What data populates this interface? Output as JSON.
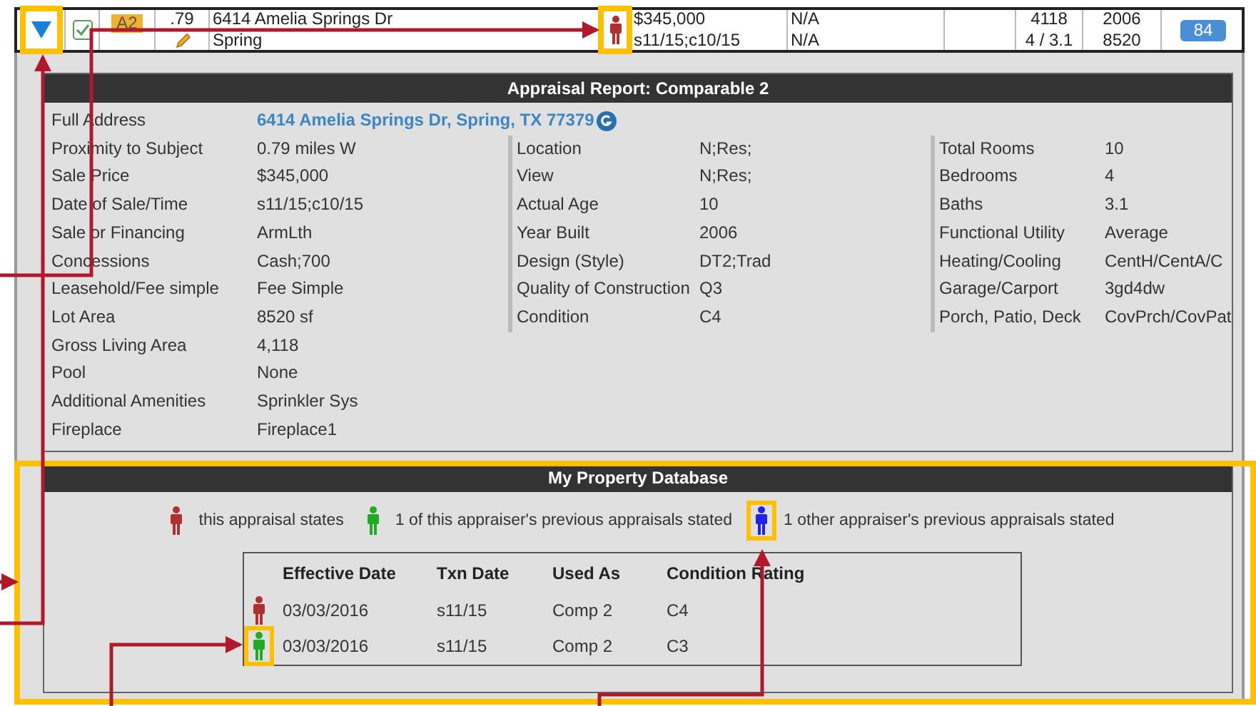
{
  "listing_row": {
    "expanded": true,
    "checked": true,
    "tag": "A2",
    "number": ".79",
    "address_lines": [
      "6414 Amelia Springs Dr",
      "Spring"
    ],
    "color": "#b03030",
    "price_lines": [
      "$345,000",
      "s11/15;c10/15"
    ],
    "column_8": [
      "N/A",
      "N/A"
    ],
    "size_lines": [
      "4118",
      "4 / 3.1"
    ],
    "year_lot_lines": [
      "2006",
      "8520"
    ],
    "score": "84"
  },
  "appraisal_report": {
    "title": "Appraisal Report: Comparable 2",
    "full_address": {
      "label": "Full Address",
      "value": "6414 Amelia Springs Dr, Spring, TX 77379"
    },
    "columns": [
      [
        {
          "label": "Proximity to Subject",
          "value": "0.79 miles W"
        },
        {
          "label": "Sale Price",
          "value": "$345,000"
        },
        {
          "label": "Date of Sale/Time",
          "value": "s11/15;c10/15"
        },
        {
          "label": "Sale or Financing",
          "value": "ArmLth"
        },
        {
          "label": "Concessions",
          "value": "Cash;700"
        },
        {
          "label": "Leasehold/Fee simple",
          "value": "Fee Simple"
        },
        {
          "label": "Lot Area",
          "value": "8520 sf"
        },
        {
          "label": "Gross Living Area",
          "value": "4,118"
        },
        {
          "label": "Pool",
          "value": "None"
        },
        {
          "label": "Additional Amenities",
          "value": "Sprinkler Sys"
        },
        {
          "label": "Fireplace",
          "value": "Fireplace1"
        }
      ],
      [
        {
          "label": "Location",
          "value": "N;Res;"
        },
        {
          "label": "View",
          "value": "N;Res;"
        },
        {
          "label": "Actual Age",
          "value": "10"
        },
        {
          "label": "Year Built",
          "value": "2006"
        },
        {
          "label": "Design (Style)",
          "value": "DT2;Trad"
        },
        {
          "label": "Quality of Construction",
          "value": "Q3"
        },
        {
          "label": "Condition",
          "value": "C4"
        }
      ],
      [
        {
          "label": "Total Rooms",
          "value": "10"
        },
        {
          "label": "Bedrooms",
          "value": "4"
        },
        {
          "label": "Baths",
          "value": "3.1"
        },
        {
          "label": "Functional Utility",
          "value": "Average"
        },
        {
          "label": "Heating/Cooling",
          "value": "CentH/CentA/C"
        },
        {
          "label": "Garage/Carport",
          "value": "3gd4dw"
        },
        {
          "label": "Porch, Patio, Deck",
          "value": "CovPrch/CovPat"
        }
      ]
    ]
  },
  "property_database": {
    "title": "My Property Database",
    "legend": [
      {
        "color": "#b03030",
        "text": "this appraisal states",
        "highlighted": false
      },
      {
        "color": "#22aa22",
        "text": "1 of this appraiser's previous appraisals stated",
        "highlighted": false
      },
      {
        "color": "#2222ee",
        "text": "1 other appraiser's previous appraisals stated",
        "highlighted": true
      }
    ],
    "table": {
      "columns": [
        "Effective Date",
        "Txn Date",
        "Used As",
        "Condition Rating"
      ],
      "rows": [
        {
          "color": "#b03030",
          "cells": [
            "03/03/2016",
            "s11/15",
            "Comp 2",
            "C4"
          ],
          "highlighted": false
        },
        {
          "color": "#22aa22",
          "cells": [
            "03/03/2016",
            "s11/15",
            "Comp 2",
            "C3"
          ],
          "highlighted": true
        }
      ]
    }
  }
}
